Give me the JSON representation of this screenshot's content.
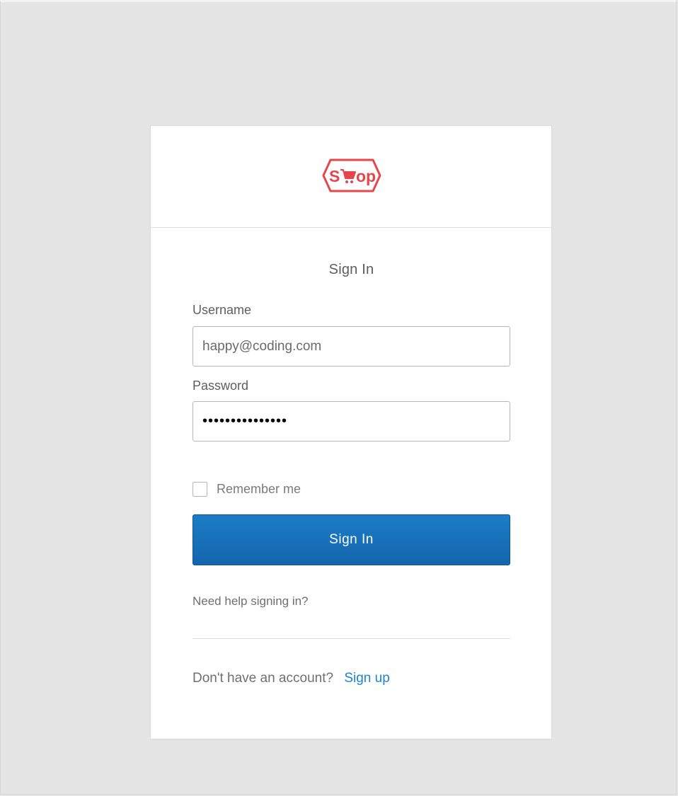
{
  "logo": {
    "text_left": "S",
    "text_right": "op",
    "icon": "shopping-cart-icon",
    "color": "#e5464b"
  },
  "form": {
    "title": "Sign In",
    "username": {
      "label": "Username",
      "value": "happy@coding.com"
    },
    "password": {
      "label": "Password",
      "value": "•••••••••••••••"
    },
    "remember_me": {
      "label": "Remember me",
      "checked": false
    },
    "submit_label": "Sign In",
    "help_link": "Need help signing in?",
    "signup_prompt": "Don't have an account?",
    "signup_link": "Sign up"
  },
  "colors": {
    "accent": "#1a73c0",
    "link": "#1f84cc",
    "background": "#e5e5e5"
  }
}
